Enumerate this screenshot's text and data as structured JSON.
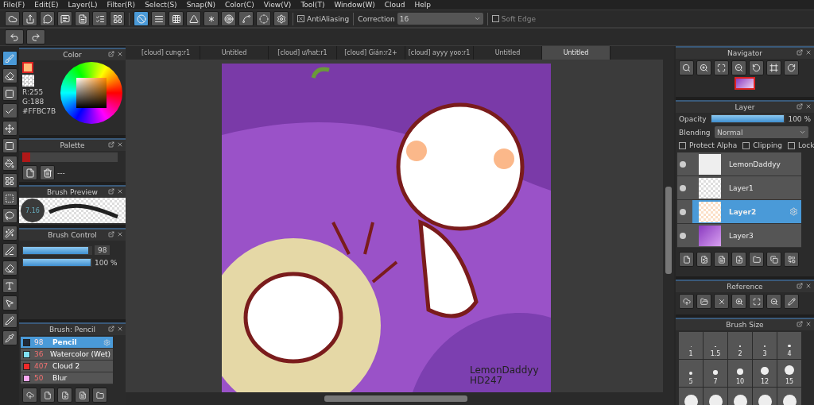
{
  "menu": [
    "File(F)",
    "Edit(E)",
    "Layer(L)",
    "Filter(R)",
    "Select(S)",
    "Snap(N)",
    "Color(C)",
    "View(V)",
    "Tool(T)",
    "Window(W)",
    "Cloud",
    "Help"
  ],
  "snap_modes": [
    {
      "selected": true
    },
    {
      "selected": false
    },
    {
      "selected": false
    },
    {
      "selected": false
    },
    {
      "selected": false
    },
    {
      "selected": false
    },
    {
      "selected": false
    },
    {
      "selected": false
    },
    {
      "selected": false
    }
  ],
  "antialiasing": {
    "label": "AntiAliasing",
    "checked": true
  },
  "correction": {
    "label": "Correction",
    "value": "16"
  },
  "soft_edge": {
    "label": "Soft Edge",
    "checked": false
  },
  "tabs": [
    {
      "label": "[cloud] cưng:r1",
      "selected": false
    },
    {
      "label": "Untitled",
      "selected": false
    },
    {
      "label": "[cloud] ư/hat:r1",
      "selected": false
    },
    {
      "label": "[cloud] Gián:r2+",
      "selected": false
    },
    {
      "label": "[cloud] ayyy yoo:r1",
      "selected": false
    },
    {
      "label": "Untitled",
      "selected": false
    },
    {
      "label": "Untitled",
      "selected": true
    }
  ],
  "tools": [
    {
      "selected": true
    },
    {
      "selected": false
    },
    {
      "selected": false
    },
    {
      "selected": false
    },
    {
      "selected": false
    },
    {
      "selected": false
    },
    {
      "selected": false
    },
    {
      "selected": false
    },
    {
      "selected": false
    },
    {
      "selected": false
    },
    {
      "selected": false
    },
    {
      "selected": false
    },
    {
      "selected": false
    },
    {
      "selected": false
    },
    {
      "selected": false
    },
    {
      "selected": false
    },
    {
      "selected": false
    }
  ],
  "color_panel": {
    "title": "Color",
    "r": "R:255",
    "g": "G:188",
    "hex": "#FFBC7B"
  },
  "palette": {
    "title": "Palette",
    "name": "---"
  },
  "brush_preview": {
    "title": "Brush Preview",
    "size": "7.16"
  },
  "brush_control": {
    "title": "Brush Control",
    "size": {
      "level": 0.96,
      "value": "98"
    },
    "opacity": {
      "level": 1,
      "value": "100 %"
    }
  },
  "brush_list": {
    "title": "Brush: Pencil",
    "items": [
      {
        "size": "98",
        "name": "Pencil",
        "color": "#1f2a3a",
        "selected": true
      },
      {
        "size": "36",
        "name": "Watercolor (Wet)",
        "color": "#7fe0f5",
        "selected": false
      },
      {
        "size": "407",
        "name": "Cloud 2",
        "color": "#ee2a2a",
        "selected": false
      },
      {
        "size": "50",
        "name": "Blur",
        "color": "#f7a8f0",
        "selected": false
      }
    ]
  },
  "canvas": {
    "signature": [
      "LemonDaddyy",
      "HD247"
    ]
  },
  "navigator": {
    "title": "Navigator"
  },
  "layer_panel": {
    "title": "Layer",
    "opacity_label": "Opacity",
    "opacity": {
      "level": 1,
      "value": "100 %"
    },
    "blending_label": "Blending",
    "blending": "Normal",
    "options": [
      {
        "label": "Protect Alpha",
        "checked": false
      },
      {
        "label": "Clipping",
        "checked": false
      },
      {
        "label": "Lock",
        "checked": false
      }
    ],
    "layers": [
      {
        "name": "LemonDaddyy",
        "kind": "text",
        "selected": false
      },
      {
        "name": "Layer1",
        "kind": "lines",
        "selected": false
      },
      {
        "name": "Layer2",
        "kind": "color",
        "selected": true
      },
      {
        "name": "Layer3",
        "kind": "background",
        "selected": false
      }
    ]
  },
  "reference": {
    "title": "Reference"
  },
  "brush_size": {
    "title": "Brush Size",
    "sizes": [
      "1",
      "1.5",
      "2",
      "3",
      "4",
      "5",
      "7",
      "10",
      "12",
      "15"
    ]
  }
}
